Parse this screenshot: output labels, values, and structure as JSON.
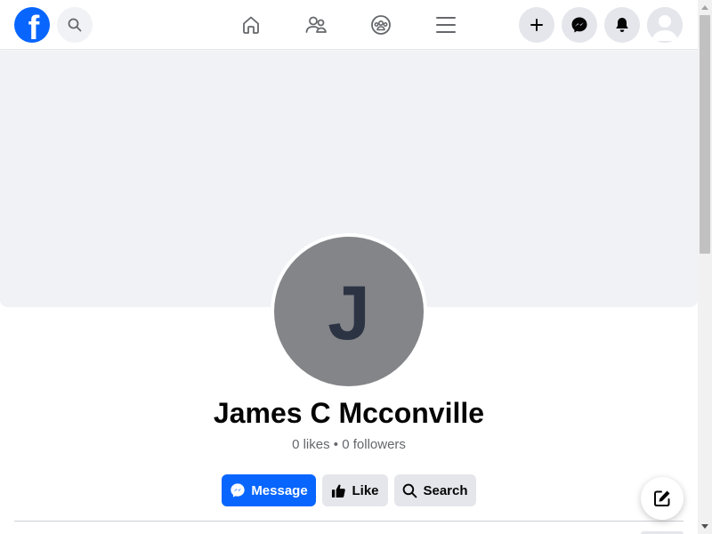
{
  "header": {
    "logo_letter": "f",
    "logo_icon": "facebook-logo-icon",
    "search_icon": "search-icon",
    "nav": [
      {
        "name": "home",
        "icon": "home-icon"
      },
      {
        "name": "friends",
        "icon": "friends-icon"
      },
      {
        "name": "groups",
        "icon": "groups-icon"
      },
      {
        "name": "menu",
        "icon": "hamburger-menu-icon"
      }
    ],
    "actions": [
      {
        "name": "create",
        "icon": "plus-icon"
      },
      {
        "name": "messenger",
        "icon": "messenger-icon"
      },
      {
        "name": "notifications",
        "icon": "bell-icon"
      }
    ],
    "account_icon": "user-avatar-icon"
  },
  "profile": {
    "avatar_letter": "J",
    "name": "James C Mcconville",
    "likes": "0 likes",
    "separator": "•",
    "followers": "0 followers"
  },
  "buttons": {
    "message": "Message",
    "like": "Like",
    "search": "Search"
  },
  "colors": {
    "brand_blue": "#0866ff",
    "avatar_bg": "#848589",
    "avatar_letter": "#2c3444",
    "cover_bg": "#f0f2f5",
    "button_gray": "#e4e6eb"
  },
  "floating": {
    "compose_icon": "compose-edit-icon"
  }
}
